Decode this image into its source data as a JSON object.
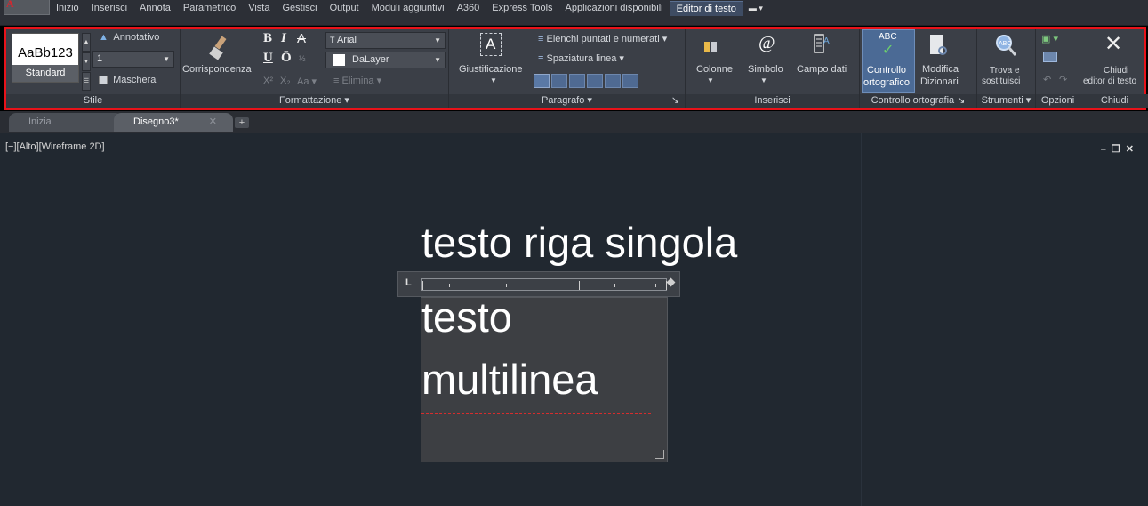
{
  "menu": {
    "items": [
      "Inizio",
      "Inserisci",
      "Annota",
      "Parametrico",
      "Vista",
      "Gestisci",
      "Output",
      "Moduli aggiuntivi",
      "A360",
      "Express Tools",
      "Applicazioni disponibili",
      "Editor di testo"
    ],
    "active": "Editor di testo"
  },
  "ribbon": {
    "stile": {
      "title": "Stile",
      "preview_sample": "AaBb123",
      "preview_name": "Standard",
      "annotativo": "Annotativo",
      "height_value": "1",
      "maschera": "Maschera"
    },
    "formattazione": {
      "title": "Formattazione",
      "match": "Corrispondenza",
      "bold": "B",
      "italic": "I",
      "strike": "A",
      "underline": "U",
      "overline": "Ō",
      "font": "Arial",
      "color": "DaLayer",
      "case": "Aa",
      "remove": "Elimina"
    },
    "paragrafo": {
      "title": "Paragrafo",
      "justify": "Giustificazione",
      "bullets": "Elenchi puntati e numerati",
      "spacing": "Spaziatura linea"
    },
    "inserisci": {
      "title": "Inserisci",
      "columns": "Colonne",
      "symbol": "Simbolo",
      "field": "Campo dati"
    },
    "controllo": {
      "title": "Controllo ortografia",
      "spell_line1": "Controllo",
      "spell_line2": "ortografico",
      "edit_line1": "Modifica",
      "edit_line2": "Dizionari",
      "abc": "ABC"
    },
    "strumenti": {
      "title": "Strumenti",
      "find_line1": "Trova e",
      "find_line2": "sostituisci"
    },
    "opzioni": {
      "title": "Opzioni"
    },
    "chiudi": {
      "title": "Chiudi",
      "close_line1": "Chiudi",
      "close_line2": "editor di testo"
    }
  },
  "tabs": [
    {
      "label": "Inizia"
    },
    {
      "label": "Disegno3*"
    }
  ],
  "viewport": {
    "label": "[−][Alto][Wireframe 2D]"
  },
  "drawing": {
    "single_line": "testo riga singola",
    "mtext_line1": "testo",
    "mtext_line2": "multilinea"
  }
}
